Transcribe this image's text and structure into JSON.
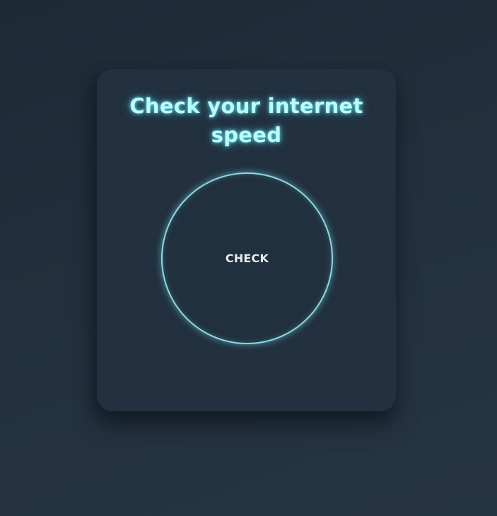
{
  "card": {
    "title": "Check your internet speed"
  },
  "speed_test": {
    "button_label": "CHECK"
  },
  "colors": {
    "title_glow": "#b9fdfd",
    "ring": "#8fd8e0",
    "card_background": "#22303f",
    "page_background": "#1f2c38"
  }
}
